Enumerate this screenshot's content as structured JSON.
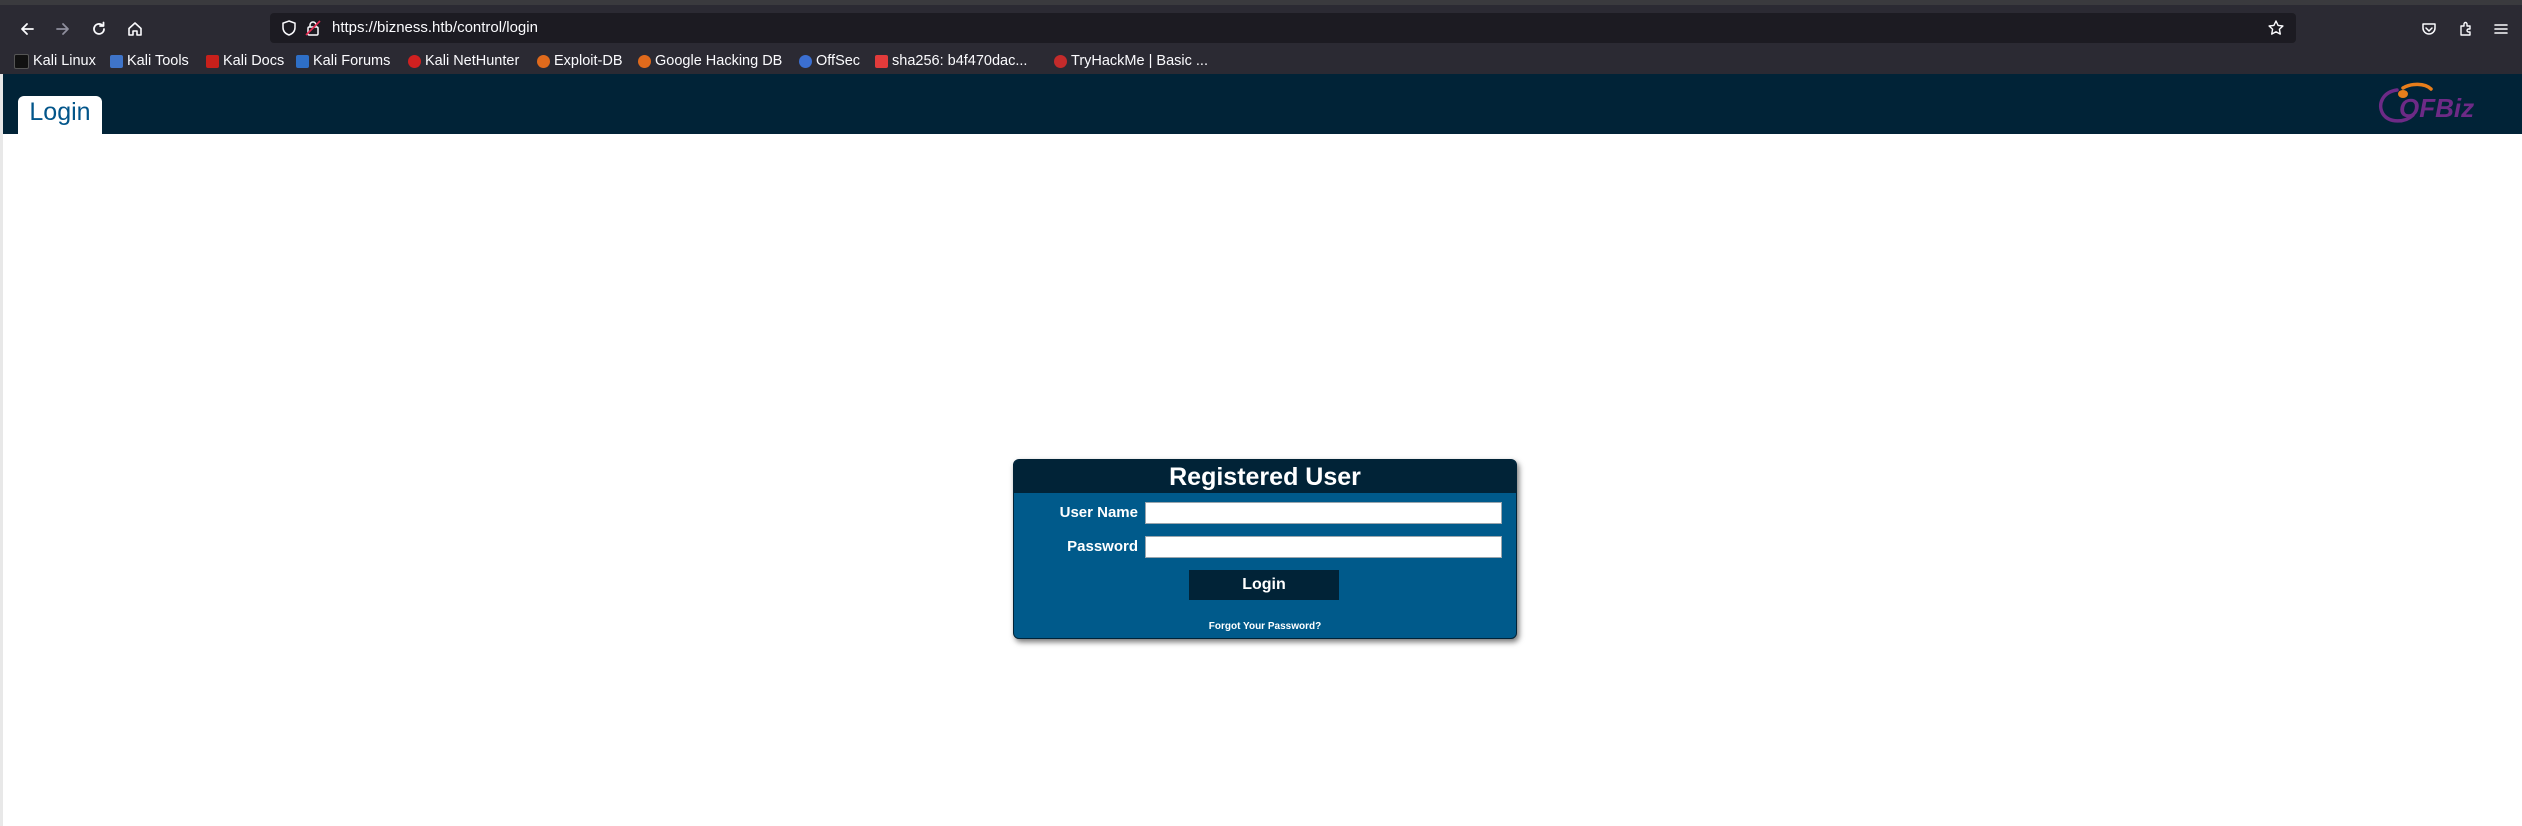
{
  "browser": {
    "url": "https://bizness.htb/control/login",
    "nav_icons": [
      "back-arrow-icon",
      "forward-arrow-icon",
      "reload-icon",
      "home-icon"
    ],
    "right_icons": [
      "pocket-icon",
      "extensions-icon",
      "menu-icon"
    ],
    "bookmarks": [
      {
        "label": "Kali Linux",
        "icon": "kali-icon",
        "color": "#111111"
      },
      {
        "label": "Kali Tools",
        "icon": "kali-tools-icon",
        "color": "#3f74c9"
      },
      {
        "label": "Kali Docs",
        "icon": "kali-docs-icon",
        "color": "#c8201b"
      },
      {
        "label": "Kali Forums",
        "icon": "kali-forums-icon",
        "color": "#2e6fc7"
      },
      {
        "label": "Kali NetHunter",
        "icon": "nethunter-icon",
        "color": "#d02020"
      },
      {
        "label": "Exploit-DB",
        "icon": "exploit-db-icon",
        "color": "#e06a1c"
      },
      {
        "label": "Google Hacking DB",
        "icon": "ghdb-icon",
        "color": "#e06a1c"
      },
      {
        "label": "OffSec",
        "icon": "offsec-icon",
        "color": "#3b6fd1"
      },
      {
        "label": "sha256: b4f470dac...",
        "icon": "sha256-icon",
        "color": "#e23b3b"
      },
      {
        "label": "TryHackMe | Basic ...",
        "icon": "tryhackme-icon",
        "color": "#c42b2b"
      }
    ]
  },
  "app": {
    "tab_label": "Login",
    "logo_text": "OFBiz",
    "colors": {
      "header": "#012337",
      "accent": "#02558a",
      "panel": "#005a8b",
      "logo_orange": "#e87e1b",
      "logo_purple": "#6d2a86"
    }
  },
  "login": {
    "title": "Registered User",
    "username_label": "User Name",
    "password_label": "Password",
    "username_value": "",
    "password_value": "",
    "button_label": "Login",
    "forgot_label": "Forgot Your Password?"
  }
}
